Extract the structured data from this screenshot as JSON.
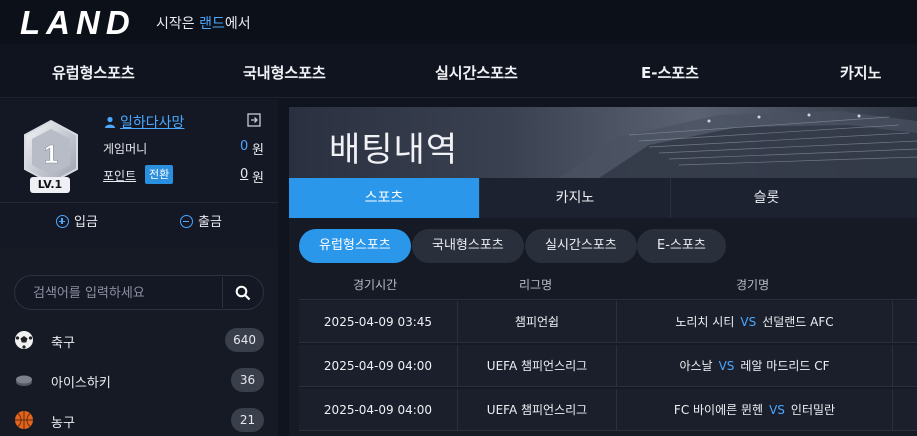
{
  "header": {
    "logo": "LAND",
    "tagline_prefix": "시작은 ",
    "tagline_highlight": "랜드",
    "tagline_suffix": "에서"
  },
  "nav": [
    "유럽형스포츠",
    "국내형스포츠",
    "실시간스포츠",
    "E-스포츠",
    "카지노"
  ],
  "user": {
    "level_number": "1",
    "level_label": "LV.1",
    "name": "일하다사망",
    "game_money_label": "게임머니",
    "game_money_value": "0",
    "point_label": "포인트",
    "switch_label": "전환",
    "point_value": "0",
    "currency": "원",
    "deposit_label": "입금",
    "withdraw_label": "출금"
  },
  "search": {
    "placeholder": "검색어를 입력하세요"
  },
  "sports": [
    {
      "name": "축구",
      "count": "640",
      "icon": "soccer-ball-icon"
    },
    {
      "name": "아이스하키",
      "count": "36",
      "icon": "hockey-puck-icon"
    },
    {
      "name": "농구",
      "count": "21",
      "icon": "basketball-icon"
    }
  ],
  "main": {
    "banner_title": "배팅내역",
    "tabs": [
      "스포츠",
      "카지노",
      "슬롯"
    ],
    "subtabs": [
      "유럽형스포츠",
      "국내형스포츠",
      "실시간스포츠",
      "E-스포츠"
    ],
    "columns": [
      "경기시간",
      "리그명",
      "경기명"
    ],
    "vs_label": "VS",
    "rows": [
      {
        "time": "2025-04-09 03:45",
        "league": "챔피언쉽",
        "home": "노리치 시티",
        "away": "선덜랜드 AFC"
      },
      {
        "time": "2025-04-09 04:00",
        "league": "UEFA 챔피언스리그",
        "home": "아스날",
        "away": "레알 마드리드 CF"
      },
      {
        "time": "2025-04-09 04:00",
        "league": "UEFA 챔피언스리그",
        "home": "FC 바이에른 뮌헨",
        "away": "인터밀란"
      }
    ]
  },
  "colors": {
    "accent": "#2b97ea",
    "link": "#4aa8ff",
    "background": "#10141f"
  }
}
